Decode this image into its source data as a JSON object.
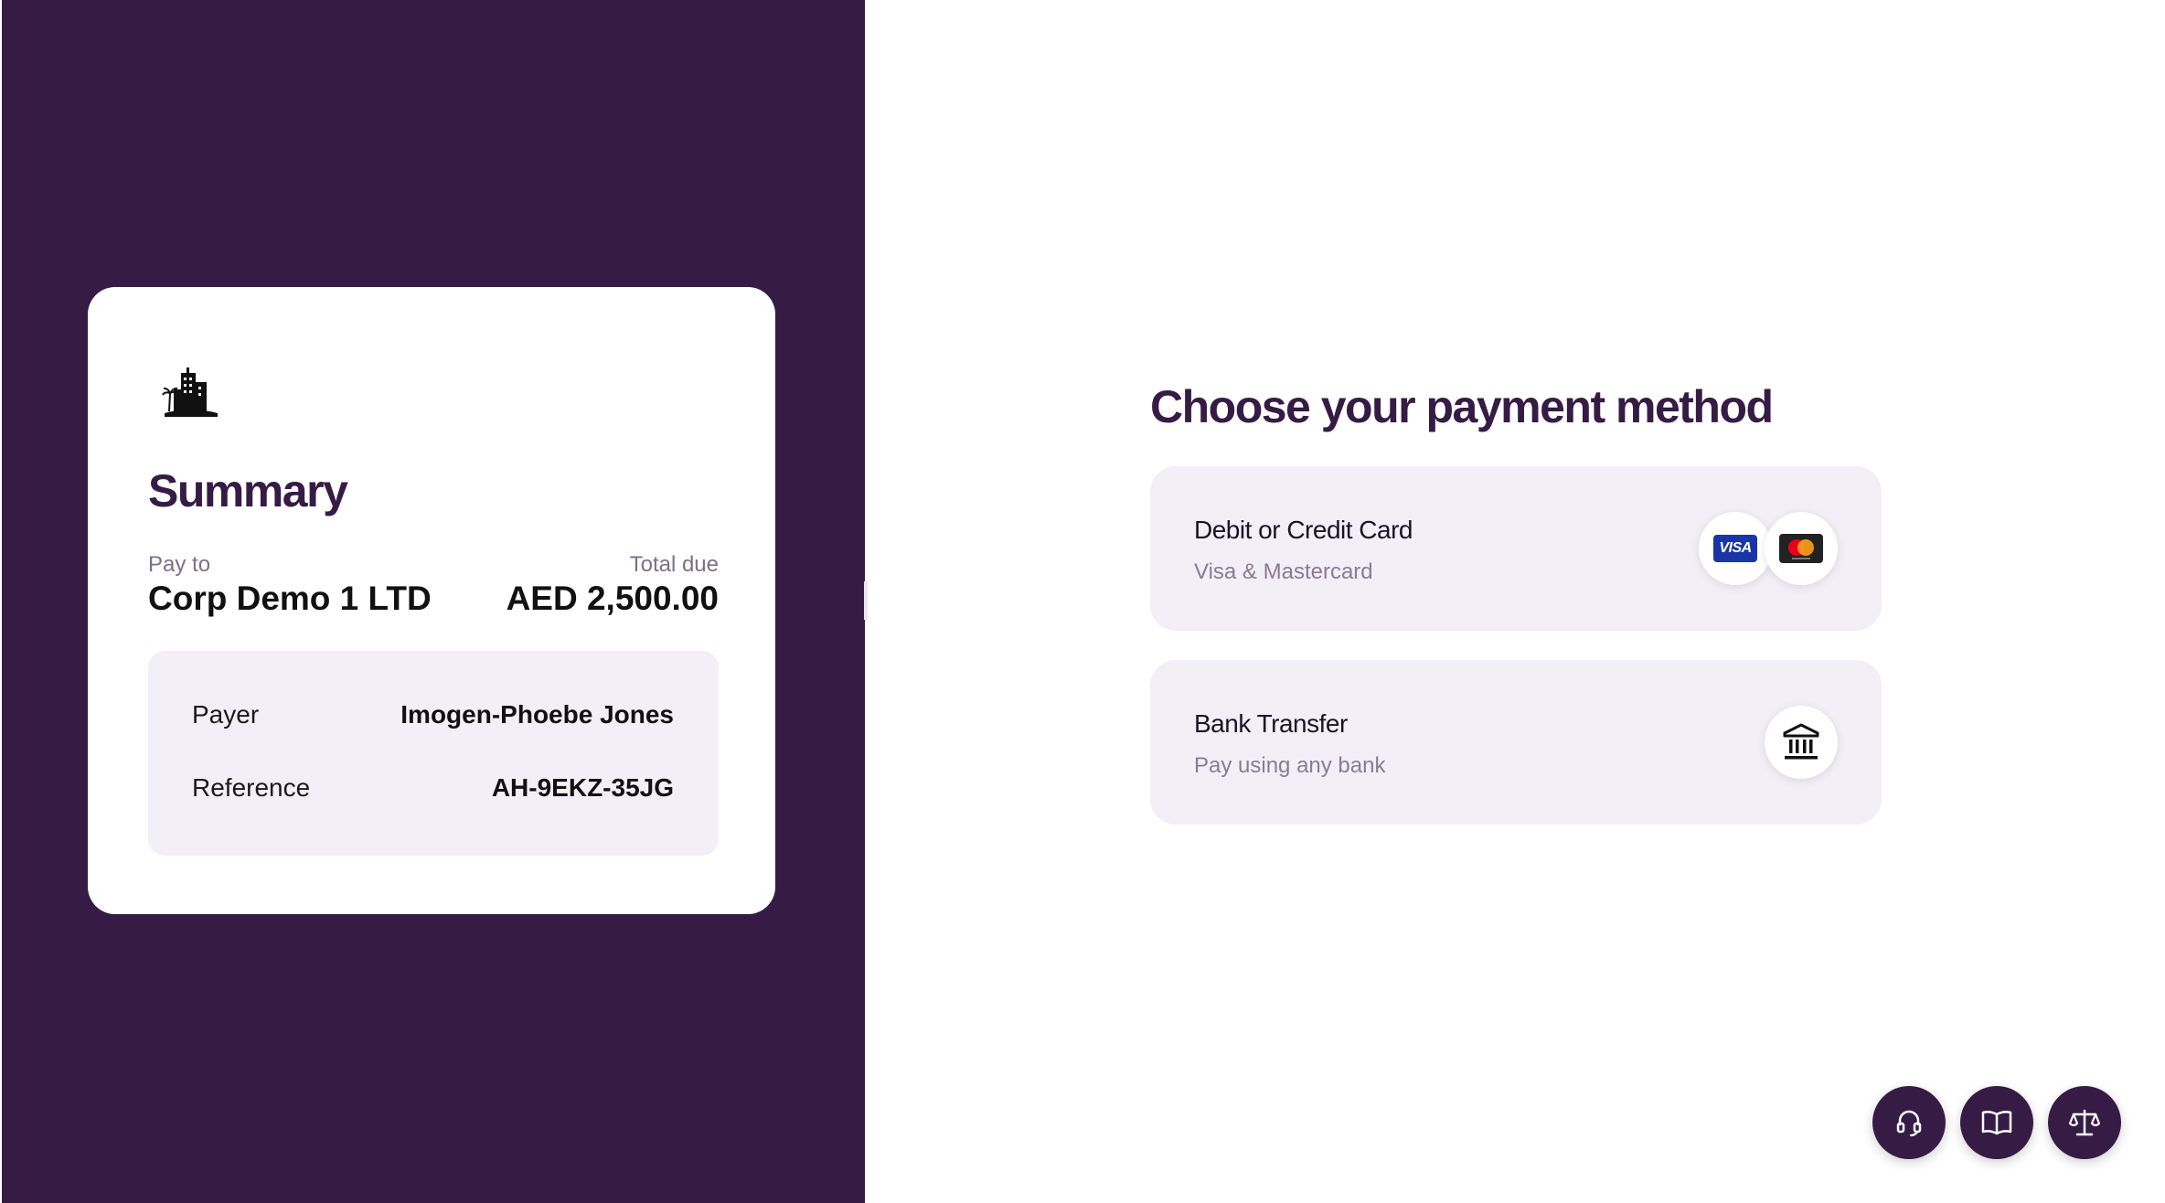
{
  "summary": {
    "title": "Summary",
    "pay_to_label": "Pay to",
    "pay_to_value": "Corp Demo 1 LTD",
    "total_label": "Total due",
    "total_value": "AED 2,500.00",
    "details": [
      {
        "label": "Payer",
        "value": "Imogen-Phoebe Jones"
      },
      {
        "label": "Reference",
        "value": "AH-9EKZ-35JG"
      }
    ]
  },
  "payment": {
    "title": "Choose your payment method",
    "methods": [
      {
        "name": "Debit or Credit Card",
        "description": "Visa & Mastercard",
        "badges": [
          "VISA",
          "mastercard"
        ]
      },
      {
        "name": "Bank Transfer",
        "description": "Pay using any bank",
        "badges": [
          "bank-icon"
        ]
      }
    ]
  },
  "fabs": [
    "headset-icon",
    "book-icon",
    "scales-icon"
  ],
  "colors": {
    "brand": "#361c45",
    "card_bg": "#f2eff6",
    "muted_text": "#8a7b95",
    "visa_blue": "#1a35a8",
    "mastercard_red": "#eb001b",
    "mastercard_orange": "#f79e1b"
  }
}
